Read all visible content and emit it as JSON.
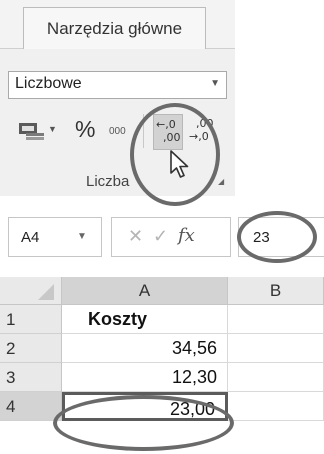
{
  "ribbon": {
    "tab_label": "Narzędzia główne",
    "number_format_value": "Liczbowe",
    "percent_label": "%",
    "comma_label": "000",
    "increase_decimal_top": "←,0",
    "increase_decimal_bottom": ",00",
    "decrease_decimal_top": ",00",
    "decrease_decimal_bottom": "→,0",
    "group_label": "Liczba"
  },
  "formula_bar": {
    "name_box": "A4",
    "cancel_icon": "✕",
    "enter_icon": "✓",
    "fx_label": "fx",
    "formula_value": "23"
  },
  "sheet": {
    "columns": [
      "A",
      "B"
    ],
    "rows": [
      {
        "row": "1",
        "a": "Koszty",
        "b": ""
      },
      {
        "row": "2",
        "a": "34,56",
        "b": ""
      },
      {
        "row": "3",
        "a": "12,30",
        "b": ""
      },
      {
        "row": "4",
        "a": "23,00",
        "b": ""
      }
    ],
    "selected_cell": "A4"
  },
  "icons": {
    "accounting": "accounting-format-icon",
    "cursor": "mouse-pointer-icon",
    "dropdown": "chevron-down-icon"
  },
  "colors": {
    "annotation": "#6a6a6a",
    "header_bg": "#e9e9e9",
    "selected_header_bg": "#d3d3d3",
    "selected_button_bg": "#d2d2d2"
  }
}
